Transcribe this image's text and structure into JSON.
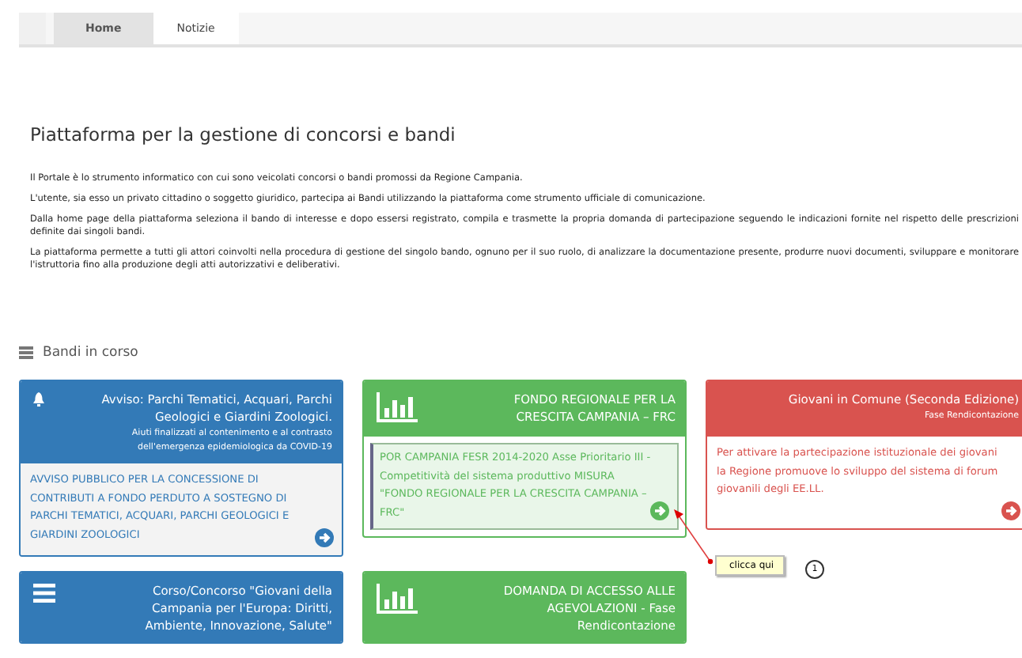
{
  "tabs": [
    {
      "label": "Home",
      "selected": true
    },
    {
      "label": "Notizie",
      "selected": false
    }
  ],
  "title": "Piattaforma per la gestione di concorsi e bandi",
  "paragraphs": [
    "Il Portale è lo strumento informatico con cui sono veicolati concorsi o bandi promossi da Regione Campania.",
    "L'utente, sia esso un privato cittadino o soggetto giuridico, partecipa ai Bandi utilizzando la piattaforma come strumento ufficiale di comunicazione.",
    "Dalla home page della piattaforma seleziona il bando di interesse e dopo essersi registrato, compila e trasmette la propria domanda di partecipazione seguendo le indicazioni fornite nel rispetto delle prescrizioni definite dai singoli bandi.",
    "La piattaforma permette a tutti gli attori coinvolti nella procedura di gestione del singolo bando, ognuno per il suo ruolo, di analizzare la documentazione presente, produrre nuovi documenti, sviluppare e monitorare l'istruttoria fino alla produzione degli atti autorizzativi e deliberativi."
  ],
  "section": {
    "label": "Bandi in corso"
  },
  "cards": [
    {
      "kind": "bell",
      "color": "#337ab7",
      "title": "Avviso: Parchi Tematici, Acquari, Parchi Geologici e Giardini Zoologici.",
      "subtitle": "Aiuti finalizzati al contenimento e al contrasto dell'emergenza epidemiologica da COVID-19",
      "body": "AVVISO PUBBLICO PER LA CONCESSIONE DI CONTRIBUTI A FONDO PERDUTO A SOSTEGNO DI PARCHI TEMATICI, ACQUARI, PARCHI GEOLOGICI E GIARDINI ZOOLOGICI"
    },
    {
      "kind": "chart",
      "color": "#5cb85c",
      "title": "FONDO REGIONALE PER LA CRESCITA CAMPANIA – FRC",
      "body": "POR CAMPANIA FESR 2014-2020 Asse Prioritario III - Competitività del sistema produttivo MISURA \"FONDO REGIONALE PER LA CRESCITA CAMPANIA – FRC\"",
      "highlighted": true
    },
    {
      "kind": "plain",
      "color": "#d9534f",
      "title": "Giovani in Comune (Seconda Edizione)",
      "subtitle": "Fase Rendicontazione",
      "body": "Per attivare la partecipazione istituzionale dei giovani la Regione promuove lo sviluppo del sistema di forum giovanili degli EE.LL."
    },
    {
      "kind": "menu",
      "color": "#337ab7",
      "title": "Corso/Concorso \"Giovani della Campania per l'Europa: Diritti, Ambiente, Innovazione, Salute\""
    },
    {
      "kind": "chart",
      "color": "#5cb85c",
      "title": "DOMANDA DI ACCESSO ALLE AGEVOLAZIONI - Fase Rendicontazione"
    }
  ],
  "callout": {
    "label": "clicca qui",
    "step": "1"
  }
}
